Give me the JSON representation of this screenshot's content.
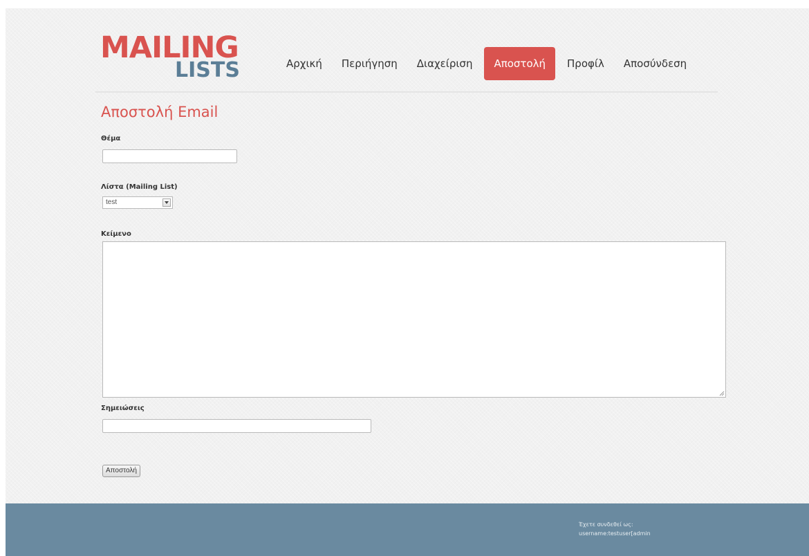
{
  "header": {
    "logo_line1": "MAILING",
    "logo_line2": "LISTS",
    "nav": [
      {
        "label": "Αρχική",
        "active": false
      },
      {
        "label": "Περιήγηση",
        "active": false
      },
      {
        "label": "Διαχείριση",
        "active": false
      },
      {
        "label": "Αποστολή",
        "active": true
      },
      {
        "label": "Προφίλ",
        "active": false
      },
      {
        "label": "Αποσύνδεση",
        "active": false
      }
    ]
  },
  "form": {
    "title": "Αποστολή Email",
    "subject_label": "Θέμα",
    "subject_value": "",
    "list_label": "Λίστα (Mailing List)",
    "list_selected": "test",
    "body_label": "Κείμενο",
    "body_value": "",
    "notes_label": "Σημειώσεις",
    "notes_value": "",
    "submit_label": "Αποστολή"
  },
  "footer": {
    "line1": "Έχετε συνδεθεί ως:",
    "line2": "username:testuser[admin"
  },
  "colors": {
    "accent": "#d9534f",
    "logo_secondary": "#5b7e96",
    "footer_bg": "#6a8aa0"
  }
}
